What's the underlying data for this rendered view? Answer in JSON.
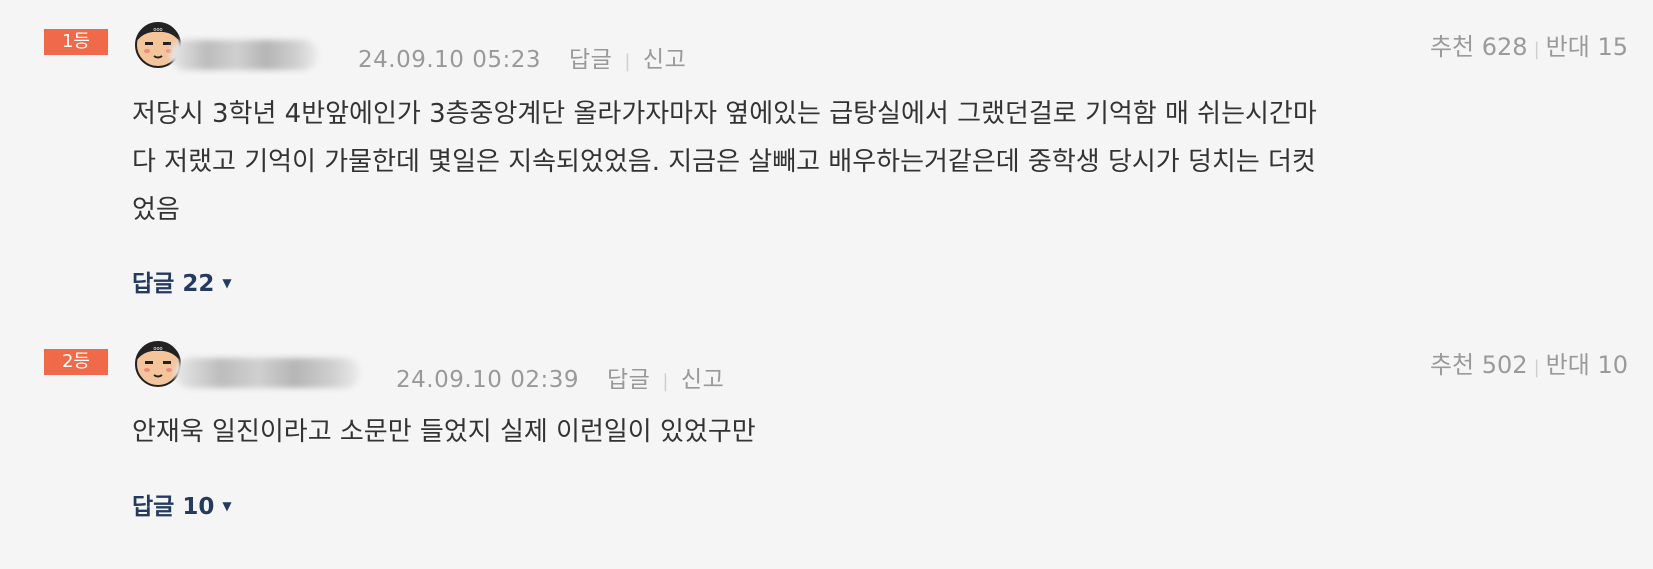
{
  "comments": [
    {
      "rank": "1등",
      "date": "24.09.10 05:23",
      "reply_action": "답글",
      "report_action": "신고",
      "recommend_label": "추천",
      "recommend_count": "628",
      "oppose_label": "반대",
      "oppose_count": "15",
      "text": "저당시 3학년 4반앞에인가 3층중앙계단 올라가자마자 옆에있는 급탕실에서 그랬던걸로 기억함 매 쉬는시간마다 저랬고 기억이 가물한데 몇일은 지속되었었음. 지금은 살빼고 배우하는거같은데 중학생 당시가 덩치는 더컷었음",
      "replies_label": "답글",
      "replies_count": "22"
    },
    {
      "rank": "2등",
      "date": "24.09.10 02:39",
      "reply_action": "답글",
      "report_action": "신고",
      "recommend_label": "추천",
      "recommend_count": "502",
      "oppose_label": "반대",
      "oppose_count": "10",
      "text": "안재욱 일진이라고 소문만 들었지 실제 이런일이 있었구만",
      "replies_label": "답글",
      "replies_count": "10"
    }
  ],
  "icons": {
    "avatar": "avatar-icon",
    "caret": "caret-down-icon"
  },
  "colors": {
    "rank_badge": "#f06a4a",
    "reply_link": "#243a5e",
    "background": "#f5f5f5"
  }
}
